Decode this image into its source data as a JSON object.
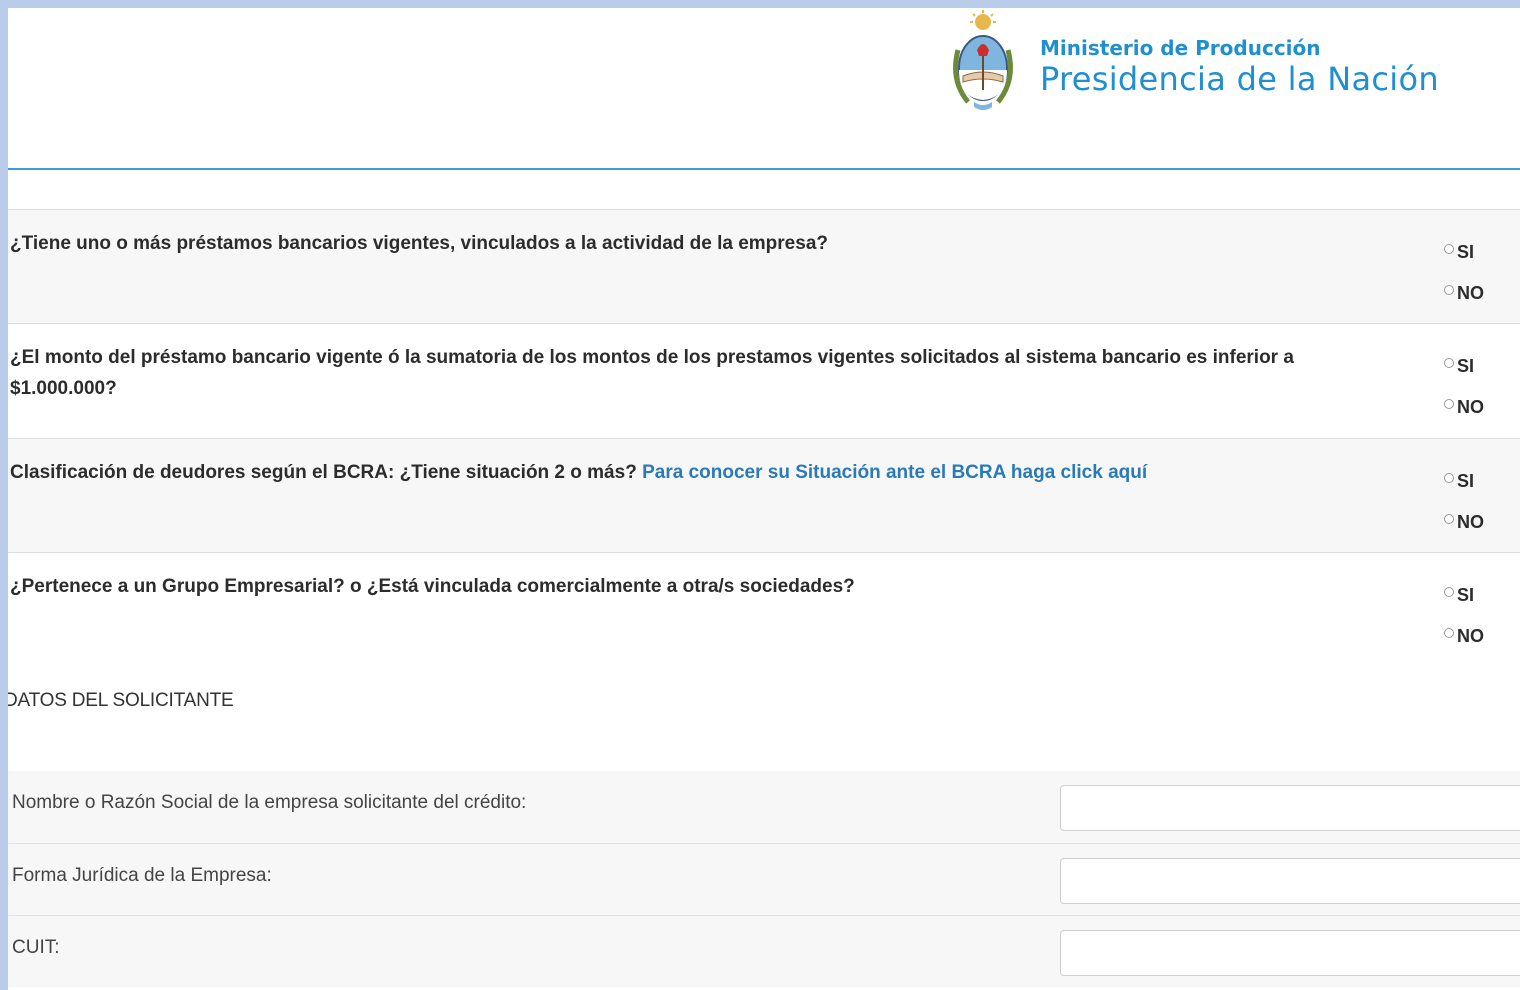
{
  "header": {
    "ministry": "Ministerio de Producción",
    "presidency": "Presidencia de la Nación"
  },
  "questions": [
    {
      "text": "¿Tiene uno o más préstamos bancarios vigentes, vinculados a la actividad de la empresa?",
      "link": "",
      "options": [
        "SI",
        "NO"
      ]
    },
    {
      "text": "¿El monto del préstamo bancario vigente ó la sumatoria de los montos de los prestamos vigentes solicitados al sistema bancario es inferior a $1.000.000?",
      "link": "",
      "options": [
        "SI",
        "NO"
      ]
    },
    {
      "text": "Clasificación de deudores según el BCRA: ¿Tiene situación 2 o más?",
      "link": "Para conocer su Situación ante el BCRA haga click aquí",
      "options": [
        "SI",
        "NO"
      ]
    },
    {
      "text": "¿Pertenece a un Grupo Empresarial? o ¿Está vinculada comercialmente a otra/s sociedades?",
      "link": "",
      "options": [
        "SI",
        "NO"
      ]
    }
  ],
  "solicitante": {
    "title": "DATOS DEL SOLICITANTE",
    "fields": [
      {
        "label": "Nombre o Razón Social de la empresa solicitante del crédito:",
        "value": ""
      },
      {
        "label": "Forma Jurídica de la Empresa:",
        "value": ""
      },
      {
        "label": "CUIT:",
        "value": ""
      }
    ]
  },
  "colors": {
    "accent": "#1f8fcf",
    "link": "#2a7ab8",
    "frame": "#b9cdea"
  }
}
